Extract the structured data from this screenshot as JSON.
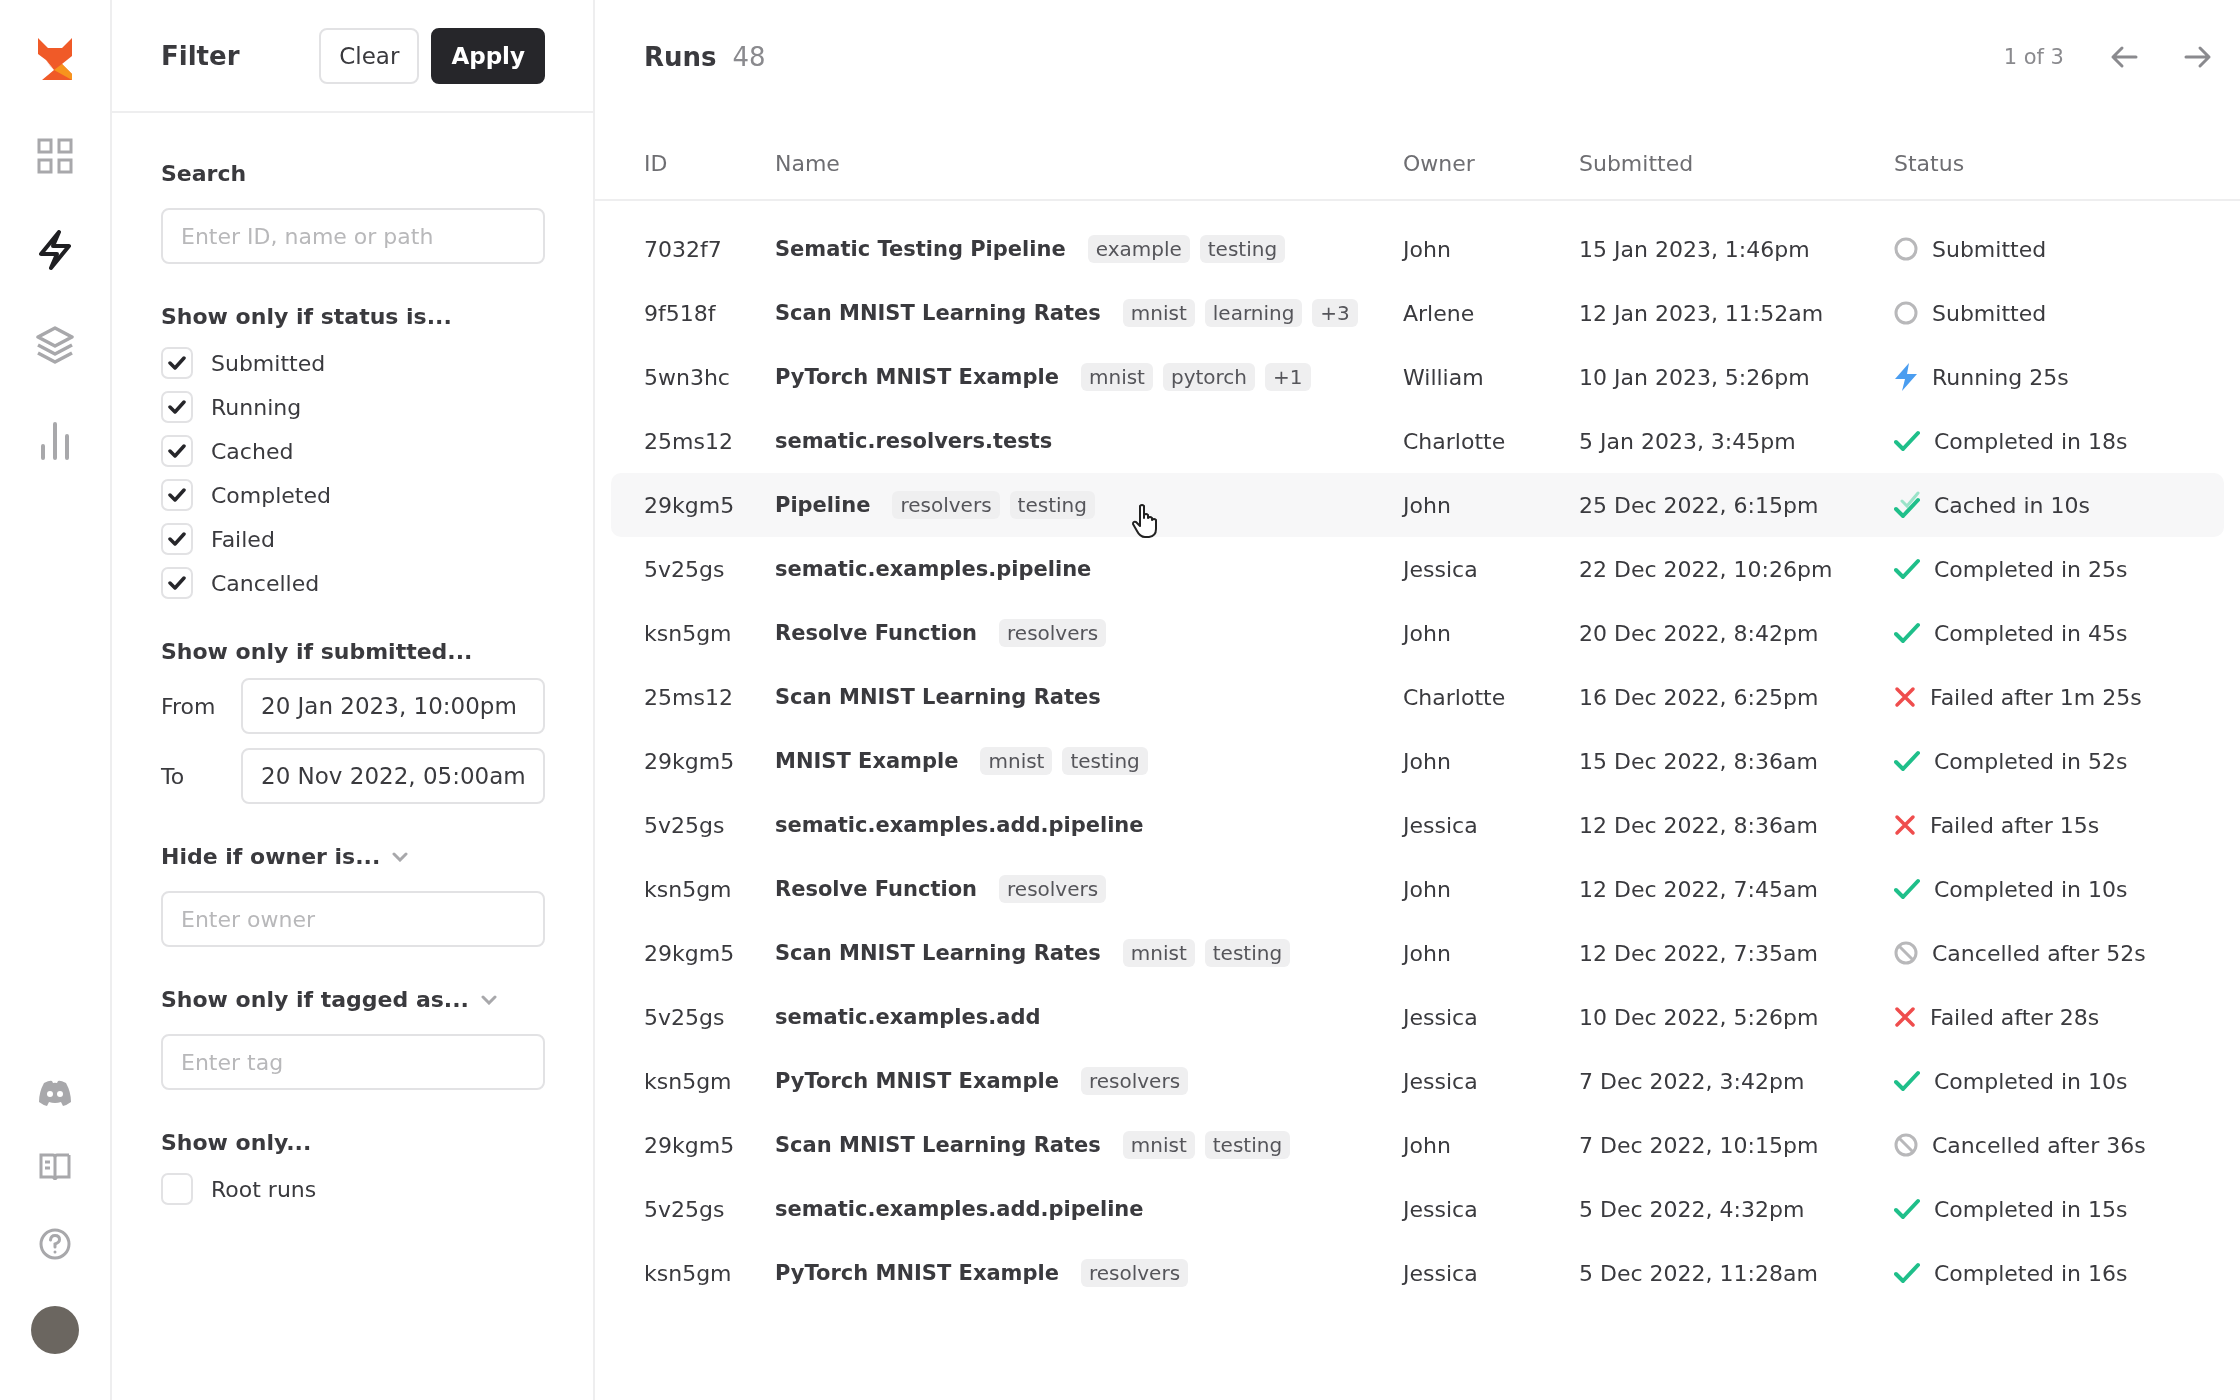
{
  "nav": {
    "top": [
      {
        "kind": "grid",
        "selected": false
      },
      {
        "kind": "bolt",
        "selected": true
      },
      {
        "kind": "layers",
        "selected": false
      },
      {
        "kind": "chart",
        "selected": false
      }
    ],
    "bottom": [
      {
        "kind": "discord"
      },
      {
        "kind": "book"
      },
      {
        "kind": "help"
      },
      {
        "kind": "avatar"
      }
    ]
  },
  "filter": {
    "title": "Filter",
    "clear": "Clear",
    "apply": "Apply",
    "search": {
      "label": "Search",
      "placeholder": "Enter ID, name or path"
    },
    "status": {
      "label": "Show only if status is...",
      "options": [
        {
          "label": "Submitted",
          "checked": true
        },
        {
          "label": "Running",
          "checked": true
        },
        {
          "label": "Cached",
          "checked": true
        },
        {
          "label": "Completed",
          "checked": true
        },
        {
          "label": "Failed",
          "checked": true
        },
        {
          "label": "Cancelled",
          "checked": true
        }
      ]
    },
    "submitted": {
      "label": "Show only if submitted...",
      "from_label": "From",
      "from": "20 Jan 2023, 10:00pm",
      "to_label": "To",
      "to": "20 Nov 2022, 05:00am"
    },
    "owner": {
      "label": "Hide if owner is...",
      "placeholder": "Enter owner"
    },
    "tags": {
      "label": "Show only if tagged as...",
      "placeholder": "Enter tag"
    },
    "only": {
      "label": "Show only...",
      "options": [
        {
          "label": "Root runs",
          "checked": false
        }
      ]
    }
  },
  "runs": {
    "title": "Runs",
    "count": "48",
    "pager": "1 of 3",
    "columns": [
      "ID",
      "Name",
      "Owner",
      "Submitted",
      "Status"
    ],
    "rows": [
      {
        "id": "7032f7",
        "name": "Sematic Testing Pipeline",
        "tags": [
          "example",
          "testing"
        ],
        "owner": "John",
        "submitted": "15 Jan 2023, 1:46pm",
        "kind": "submitted",
        "status": "Submitted",
        "highlighted": false
      },
      {
        "id": "9f518f",
        "name": "Scan MNIST Learning Rates",
        "tags": [
          "mnist",
          "learning",
          "+3"
        ],
        "owner": "Arlene",
        "submitted": "12 Jan 2023, 11:52am",
        "kind": "submitted",
        "status": "Submitted",
        "highlighted": false
      },
      {
        "id": "5wn3hc",
        "name": "PyTorch MNIST Example",
        "tags": [
          "mnist",
          "pytorch",
          "+1"
        ],
        "owner": "William",
        "submitted": "10 Jan 2023, 5:26pm",
        "kind": "running",
        "status": "Running 25s",
        "highlighted": false
      },
      {
        "id": "25ms12",
        "name": "sematic.resolvers.tests",
        "tags": [],
        "owner": "Charlotte",
        "submitted": "5 Jan 2023, 3:45pm",
        "kind": "completed",
        "status": "Completed in 18s",
        "highlighted": false
      },
      {
        "id": "29kgm5",
        "name": "Pipeline",
        "tags": [
          "resolvers",
          "testing"
        ],
        "owner": "John",
        "submitted": "25 Dec 2022, 6:15pm",
        "kind": "cached",
        "status": "Cached in 10s",
        "highlighted": true
      },
      {
        "id": "5v25gs",
        "name": "sematic.examples.pipeline",
        "tags": [],
        "owner": "Jessica",
        "submitted": "22 Dec 2022, 10:26pm",
        "kind": "completed",
        "status": "Completed in 25s",
        "highlighted": false
      },
      {
        "id": "ksn5gm",
        "name": "Resolve Function",
        "tags": [
          "resolvers"
        ],
        "owner": "John",
        "submitted": "20 Dec 2022, 8:42pm",
        "kind": "completed",
        "status": "Completed in 45s",
        "highlighted": false
      },
      {
        "id": "25ms12",
        "name": "Scan MNIST Learning Rates",
        "tags": [],
        "owner": "Charlotte",
        "submitted": "16 Dec 2022, 6:25pm",
        "kind": "failed",
        "status": "Failed after 1m 25s",
        "highlighted": false
      },
      {
        "id": "29kgm5",
        "name": "MNIST Example",
        "tags": [
          "mnist",
          "testing"
        ],
        "owner": "John",
        "submitted": "15 Dec 2022, 8:36am",
        "kind": "completed",
        "status": "Completed in 52s",
        "highlighted": false
      },
      {
        "id": "5v25gs",
        "name": "sematic.examples.add.pipeline",
        "tags": [],
        "owner": "Jessica",
        "submitted": "12 Dec 2022, 8:36am",
        "kind": "failed",
        "status": "Failed after 15s",
        "highlighted": false
      },
      {
        "id": "ksn5gm",
        "name": "Resolve Function",
        "tags": [
          "resolvers"
        ],
        "owner": "John",
        "submitted": "12 Dec 2022, 7:45am",
        "kind": "completed",
        "status": "Completed in 10s",
        "highlighted": false
      },
      {
        "id": "29kgm5",
        "name": "Scan MNIST Learning Rates",
        "tags": [
          "mnist",
          "testing"
        ],
        "owner": "John",
        "submitted": "12 Dec 2022, 7:35am",
        "kind": "cancelled",
        "status": "Cancelled after 52s",
        "highlighted": false
      },
      {
        "id": "5v25gs",
        "name": "sematic.examples.add",
        "tags": [],
        "owner": "Jessica",
        "submitted": "10 Dec 2022, 5:26pm",
        "kind": "failed",
        "status": "Failed after 28s",
        "highlighted": false
      },
      {
        "id": "ksn5gm",
        "name": "PyTorch MNIST Example",
        "tags": [
          "resolvers"
        ],
        "owner": "Jessica",
        "submitted": "7 Dec 2022, 3:42pm",
        "kind": "completed",
        "status": "Completed in 10s",
        "highlighted": false
      },
      {
        "id": "29kgm5",
        "name": "Scan MNIST Learning Rates",
        "tags": [
          "mnist",
          "testing"
        ],
        "owner": "John",
        "submitted": "7 Dec 2022, 10:15pm",
        "kind": "cancelled",
        "status": "Cancelled after 36s",
        "highlighted": false
      },
      {
        "id": "5v25gs",
        "name": "sematic.examples.add.pipeline",
        "tags": [],
        "owner": "Jessica",
        "submitted": "5 Dec 2022, 4:32pm",
        "kind": "completed",
        "status": "Completed in 15s",
        "highlighted": false
      },
      {
        "id": "ksn5gm",
        "name": "PyTorch MNIST Example",
        "tags": [
          "resolvers"
        ],
        "owner": "Jessica",
        "submitted": "5 Dec 2022, 11:28am",
        "kind": "completed",
        "status": "Completed in 16s",
        "highlighted": false
      }
    ]
  }
}
